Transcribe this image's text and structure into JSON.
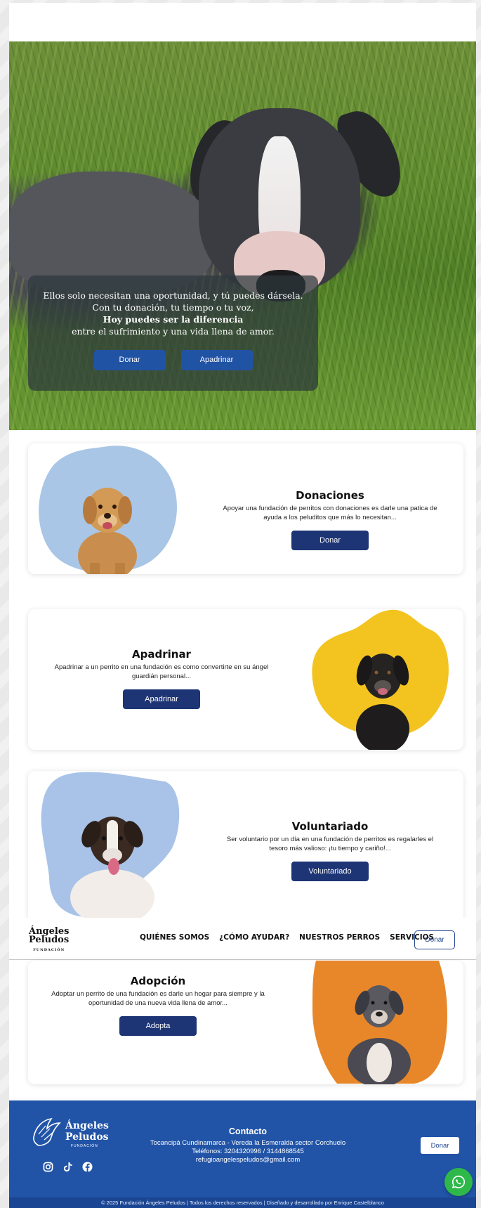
{
  "hero": {
    "line1": "Ellos solo necesitan una oportunidad, y tú puedes dársela.",
    "line2": "Con tu donación, tu tiempo o tu voz,",
    "line3": "Hoy puedes ser la diferencia",
    "line4": "entre el sufrimiento y una vida llena de amor.",
    "btn_donar": "Donar",
    "btn_apadrinar": "Apadrinar"
  },
  "cards": [
    {
      "title": "Donaciones",
      "desc": "Apoyar una fundación de perritos con donaciones es darle una patica de ayuda a los peluditos que más lo necesitan...",
      "button": "Donar",
      "blob_color": "#a9c6e6"
    },
    {
      "title": "Apadrinar",
      "desc": "Apadrinar a un perrito en una fundación es como convertirte en su ángel guardián personal...",
      "button": "Apadrinar",
      "blob_color": "#f3c420"
    },
    {
      "title": "Voluntariado",
      "desc": "Ser voluntario por un día en una fundación de perritos es regalarles el tesoro más valioso: ¡tu tiempo y cariño!...",
      "button": "Voluntariado",
      "blob_color": "#a9c3e8"
    },
    {
      "title": "Adopción",
      "desc": "Adoptar un perrito de una fundación es darle un hogar para siempre y la oportunidad de una nueva vida llena de amor...",
      "button": "Adopta",
      "blob_color": "#e8872a"
    }
  ],
  "nav": {
    "logo_line1": "Ángeles",
    "logo_line2": "Peludos",
    "logo_line3": "FUNDACIÓN",
    "links": [
      "QUIÉNES SOMOS",
      "¿CÓMO AYUDAR?",
      "NUESTROS PERROS",
      "SERVICIOS"
    ],
    "donar": "Donar"
  },
  "footer": {
    "logo_line1": "Ángeles",
    "logo_line2": "Peludos",
    "logo_line3": "FUNDACIÓN",
    "contact_title": "Contacto",
    "address": "Tocancipá Cundinamarca - Vereda la Esmeralda sector Corchuelo",
    "phones": "Teléfonos: 3204320996 / 3144868545",
    "email": "refugioangelespeludos@gmail.com",
    "donar": "Donar",
    "copyright": "© 2025 Fundación Ángeles Peludos | Todos los derechos reservados | Diseñado y desarrollado por Enrique Castelblanco"
  },
  "icons": [
    "instagram-icon",
    "tiktok-icon",
    "facebook-icon",
    "whatsapp-icon"
  ]
}
